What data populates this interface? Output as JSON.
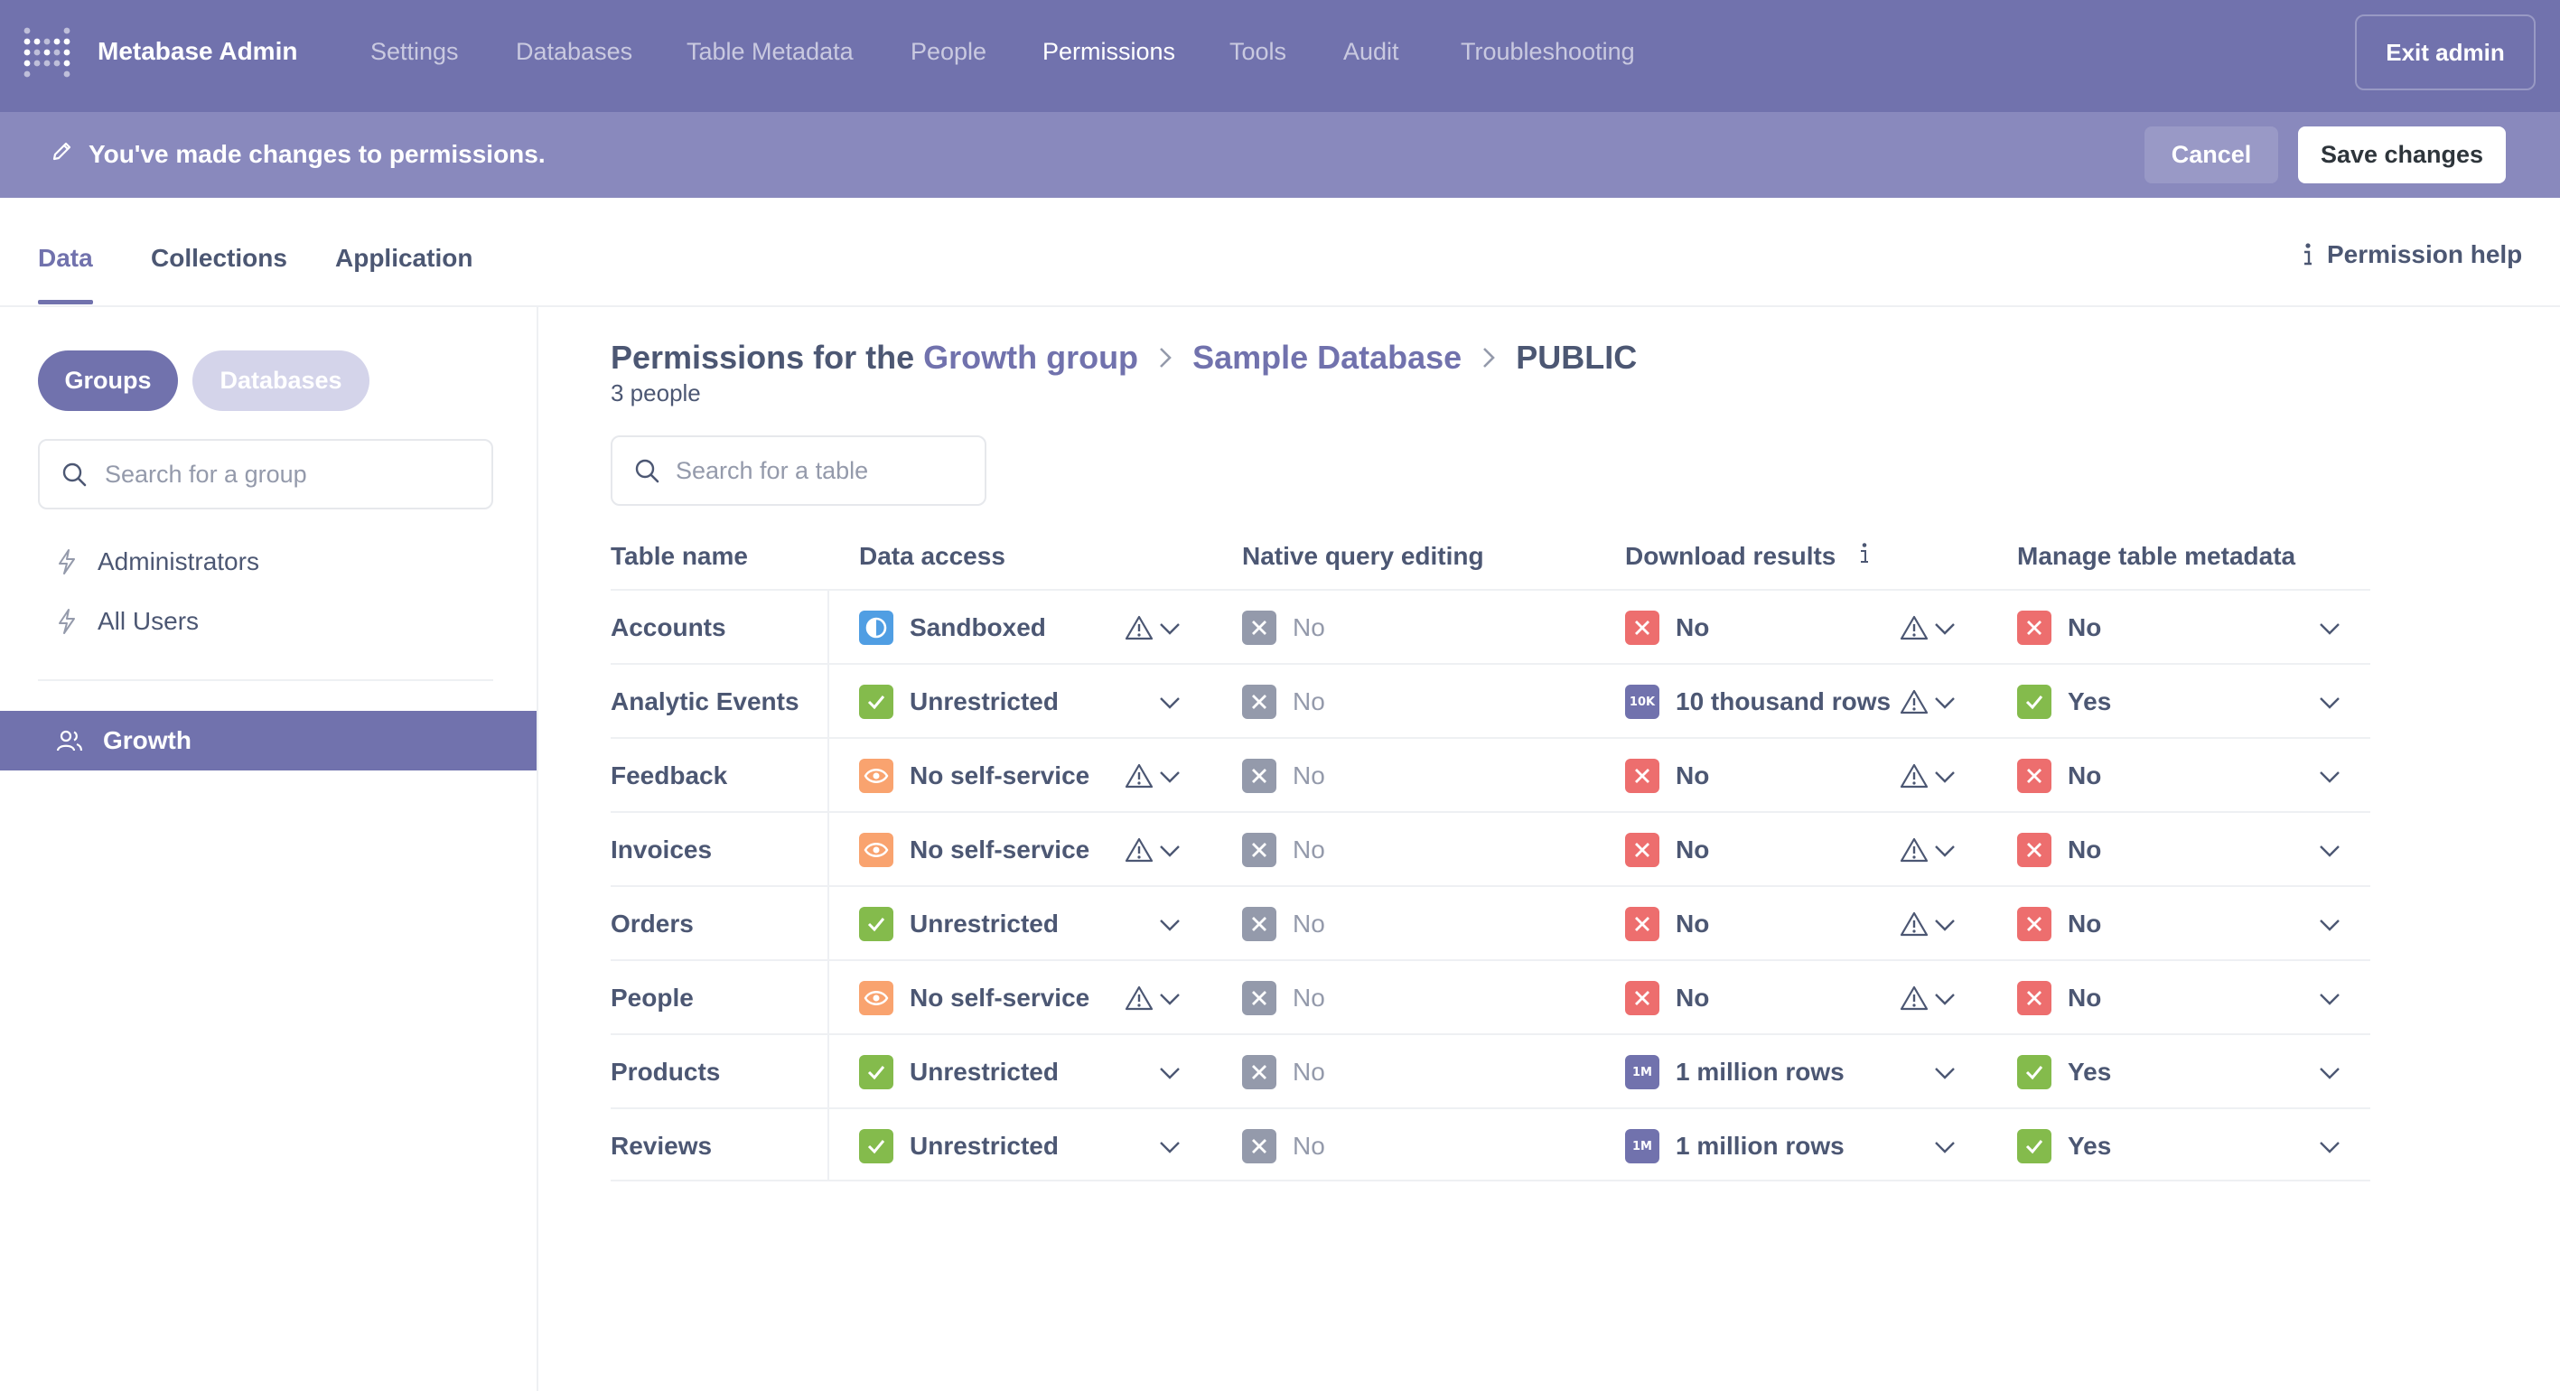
{
  "topnav": {
    "brand": "Metabase Admin",
    "items": [
      {
        "label": "Settings"
      },
      {
        "label": "Databases"
      },
      {
        "label": "Table Metadata"
      },
      {
        "label": "People"
      },
      {
        "label": "Permissions",
        "active": true
      },
      {
        "label": "Tools"
      },
      {
        "label": "Audit"
      },
      {
        "label": "Troubleshooting"
      }
    ],
    "exit_label": "Exit admin",
    "background": "#7172ad"
  },
  "changes_bar": {
    "message": "You've made changes to permissions.",
    "cancel_label": "Cancel",
    "save_label": "Save changes"
  },
  "tabs": {
    "items": [
      {
        "label": "Data",
        "active": true
      },
      {
        "label": "Collections"
      },
      {
        "label": "Application"
      }
    ],
    "help_label": "Permission help"
  },
  "sidebar": {
    "toggle": {
      "groups_label": "Groups",
      "databases_label": "Databases"
    },
    "search_placeholder": "Search for a group",
    "special_groups": [
      {
        "label": "Administrators",
        "icon": "bolt-icon"
      },
      {
        "label": "All Users",
        "icon": "bolt-icon"
      }
    ],
    "groups": [
      {
        "label": "Growth",
        "icon": "people-icon",
        "active": true
      }
    ]
  },
  "main": {
    "breadcrumb": {
      "prefix": "Permissions for the",
      "group": "Growth group",
      "database": "Sample Database",
      "schema": "PUBLIC"
    },
    "subtitle": "3 people",
    "search_placeholder": "Search for a table",
    "columns": [
      "Table name",
      "Data access",
      "Native query editing",
      "Download results",
      "Manage table metadata"
    ],
    "rows": [
      {
        "name": "Accounts",
        "data_access": {
          "label": "Sandboxed",
          "icon": "sandboxed",
          "warn": true
        },
        "native": {
          "label": "No"
        },
        "download": {
          "label": "No",
          "icon": "no",
          "warn": true
        },
        "metadata": {
          "label": "No",
          "icon": "no"
        }
      },
      {
        "name": "Analytic Events",
        "data_access": {
          "label": "Unrestricted",
          "icon": "yes",
          "warn": false
        },
        "native": {
          "label": "No"
        },
        "download": {
          "label": "10 thousand rows",
          "icon": "10k",
          "badge": "10K",
          "warn": true
        },
        "metadata": {
          "label": "Yes",
          "icon": "yes"
        }
      },
      {
        "name": "Feedback",
        "data_access": {
          "label": "No self-service",
          "icon": "eye",
          "warn": true
        },
        "native": {
          "label": "No"
        },
        "download": {
          "label": "No",
          "icon": "no",
          "warn": true
        },
        "metadata": {
          "label": "No",
          "icon": "no"
        }
      },
      {
        "name": "Invoices",
        "data_access": {
          "label": "No self-service",
          "icon": "eye",
          "warn": true
        },
        "native": {
          "label": "No"
        },
        "download": {
          "label": "No",
          "icon": "no",
          "warn": true
        },
        "metadata": {
          "label": "No",
          "icon": "no"
        }
      },
      {
        "name": "Orders",
        "data_access": {
          "label": "Unrestricted",
          "icon": "yes",
          "warn": false
        },
        "native": {
          "label": "No"
        },
        "download": {
          "label": "No",
          "icon": "no",
          "warn": true
        },
        "metadata": {
          "label": "No",
          "icon": "no"
        }
      },
      {
        "name": "People",
        "data_access": {
          "label": "No self-service",
          "icon": "eye",
          "warn": true
        },
        "native": {
          "label": "No"
        },
        "download": {
          "label": "No",
          "icon": "no",
          "warn": true
        },
        "metadata": {
          "label": "No",
          "icon": "no"
        }
      },
      {
        "name": "Products",
        "data_access": {
          "label": "Unrestricted",
          "icon": "yes",
          "warn": false
        },
        "native": {
          "label": "No"
        },
        "download": {
          "label": "1 million rows",
          "icon": "1m",
          "badge": "1M",
          "warn": false
        },
        "metadata": {
          "label": "Yes",
          "icon": "yes"
        }
      },
      {
        "name": "Reviews",
        "data_access": {
          "label": "Unrestricted",
          "icon": "yes",
          "warn": false
        },
        "native": {
          "label": "No"
        },
        "download": {
          "label": "1 million rows",
          "icon": "1m",
          "badge": "1M",
          "warn": false
        },
        "metadata": {
          "label": "Yes",
          "icon": "yes"
        }
      }
    ]
  },
  "colors": {
    "brand": "#7172ad",
    "yes": "#84bb4c",
    "no": "#ed6e6e",
    "native_no": "#949aab",
    "eye": "#f9a36f",
    "sandboxed": "#509ee3",
    "limit": "#7172ad"
  }
}
